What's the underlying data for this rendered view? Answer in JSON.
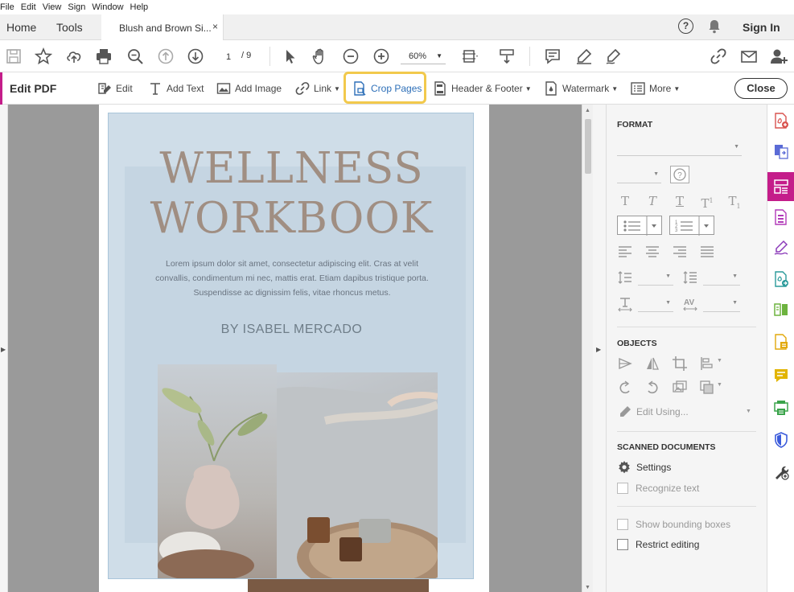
{
  "menu": [
    "File",
    "Edit",
    "View",
    "Sign",
    "Window",
    "Help"
  ],
  "tabs": {
    "home": "Home",
    "tools": "Tools",
    "doc_title": "Blush and Brown Si...",
    "close": "×"
  },
  "header": {
    "help": "?",
    "sign_in": "Sign In"
  },
  "toolbar": {
    "page_current": "1",
    "page_total": "/ 9",
    "zoom": "60%"
  },
  "editbar": {
    "title": "Edit PDF",
    "edit": "Edit",
    "add_text": "Add Text",
    "add_image": "Add Image",
    "link": "Link",
    "crop_pages": "Crop Pages",
    "header_footer": "Header & Footer",
    "watermark": "Watermark",
    "more": "More",
    "close": "Close"
  },
  "document": {
    "title_line1": "WELLNESS",
    "title_line2": "WORKBOOK",
    "body": "Lorem ipsum dolor sit amet, consectetur adipiscing elit. Cras at velit convallis, condimentum mi nec, mattis erat. Etiam dapibus tristique porta. Suspendisse ac dignissim felis, vitae rhoncus metus.",
    "author": "BY ISABEL MERCADO"
  },
  "panel": {
    "format": "FORMAT",
    "objects": "OBJECTS",
    "edit_using": "Edit Using...",
    "scanned": "SCANNED DOCUMENTS",
    "settings": "Settings",
    "recognize_text": "Recognize text",
    "show_bounding": "Show bounding boxes",
    "restrict_editing": "Restrict editing"
  },
  "colors": {
    "accent": "#c41d8a",
    "highlight": "#f2c94c",
    "link_blue": "#2d6fb8",
    "cover_bg": "#cfdde8",
    "title_brown": "#a08e82"
  }
}
